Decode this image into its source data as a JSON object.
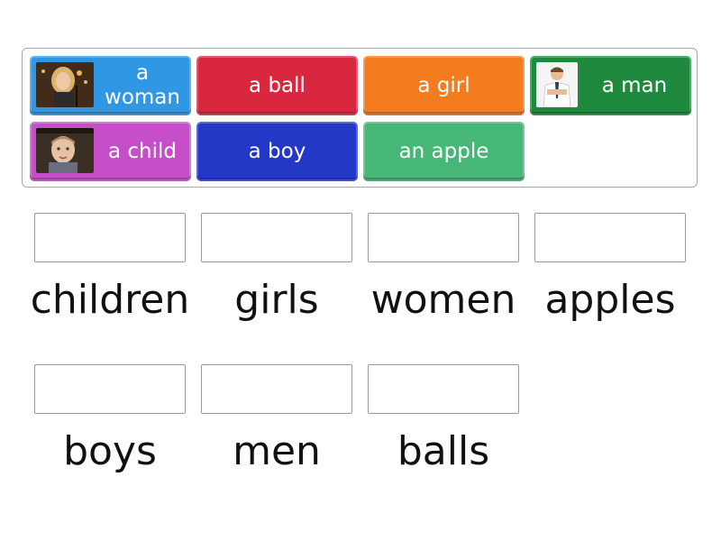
{
  "tiles": [
    {
      "label": "a woman",
      "color": "#2f97e4",
      "image": "woman-photo"
    },
    {
      "label": "a ball",
      "color": "#d9273f",
      "image": null
    },
    {
      "label": "a girl",
      "color": "#f47b1e",
      "image": null
    },
    {
      "label": "a man",
      "color": "#1f8a3d",
      "image": "man-photo"
    },
    {
      "label": "a child",
      "color": "#c64fc9",
      "image": "child-photo"
    },
    {
      "label": "a boy",
      "color": "#2438c8",
      "image": null
    },
    {
      "label": "an apple",
      "color": "#46b777",
      "image": null
    }
  ],
  "targets": [
    {
      "word": "children"
    },
    {
      "word": "girls"
    },
    {
      "word": "women"
    },
    {
      "word": "apples"
    },
    {
      "word": "boys"
    },
    {
      "word": "men"
    },
    {
      "word": "balls"
    }
  ]
}
